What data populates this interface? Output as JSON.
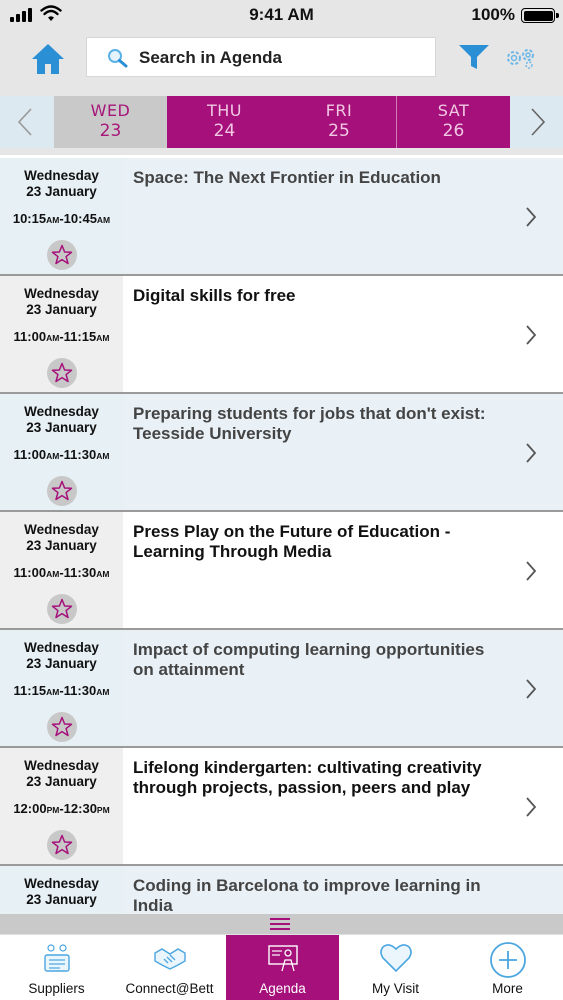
{
  "status_bar": {
    "time": "9:41 AM",
    "battery": "100%"
  },
  "header": {
    "search_placeholder": "Search in Agenda",
    "icons": {
      "home": "home-icon",
      "filter": "filter-icon",
      "settings": "settings-icon"
    }
  },
  "date_bar": {
    "days": [
      {
        "dow": "WED",
        "num": "23"
      },
      {
        "dow": "THU",
        "num": "24"
      },
      {
        "dow": "FRI",
        "num": "25"
      },
      {
        "dow": "SAT",
        "num": "26"
      }
    ]
  },
  "sessions": [
    {
      "day": "Wednesday",
      "date": "23 January",
      "start": "10:15",
      "start_ap": "AM",
      "end": "10:45",
      "end_ap": "AM",
      "title": "Space: The Next Frontier in Education"
    },
    {
      "day": "Wednesday",
      "date": "23 January",
      "start": "11:00",
      "start_ap": "AM",
      "end": "11:15",
      "end_ap": "AM",
      "title": "Digital skills for free"
    },
    {
      "day": "Wednesday",
      "date": "23 January",
      "start": "11:00",
      "start_ap": "AM",
      "end": "11:30",
      "end_ap": "AM",
      "title": "Preparing students for jobs that don't exist: Teesside University"
    },
    {
      "day": "Wednesday",
      "date": "23 January",
      "start": "11:00",
      "start_ap": "AM",
      "end": "11:30",
      "end_ap": "AM",
      "title": "Press Play on the Future of Education - Learning Through Media"
    },
    {
      "day": "Wednesday",
      "date": "23 January",
      "start": "11:15",
      "start_ap": "AM",
      "end": "11:30",
      "end_ap": "AM",
      "title": "Impact of computing learning opportunities on attainment"
    },
    {
      "day": "Wednesday",
      "date": "23 January",
      "start": "12:00",
      "start_ap": "PM",
      "end": "12:30",
      "end_ap": "PM",
      "title": "Lifelong kindergarten: cultivating creativity through projects, passion, peers and play"
    },
    {
      "day": "Wednesday",
      "date": "23 January",
      "start": "",
      "start_ap": "",
      "end": "",
      "end_ap": "",
      "title": "Coding in Barcelona to improve learning in India"
    }
  ],
  "tabs": [
    {
      "label": "Suppliers",
      "icon": "suppliers-icon"
    },
    {
      "label": "Connect@Bett",
      "icon": "handshake-icon"
    },
    {
      "label": "Agenda",
      "icon": "agenda-icon"
    },
    {
      "label": "My Visit",
      "icon": "heart-icon"
    },
    {
      "label": "More",
      "icon": "plus-circle-icon"
    }
  ],
  "colors": {
    "accent": "#a6107a",
    "icon_blue": "#2b8fd6",
    "header_bg": "#e6e6e6"
  }
}
